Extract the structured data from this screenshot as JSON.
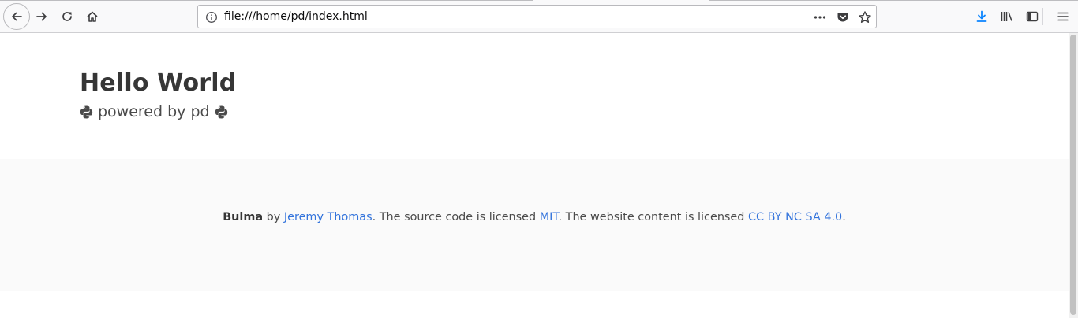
{
  "browser": {
    "url": "file:///home/pd/index.html",
    "icons": {
      "back": "arrow-left-icon",
      "forward": "arrow-right-icon",
      "reload": "reload-icon",
      "home": "home-icon",
      "info": "info-icon",
      "more": "more-dots-icon",
      "pocket": "pocket-icon",
      "bookmark": "star-icon",
      "downloads": "download-icon",
      "library": "library-icon",
      "sidebar": "sidebar-icon",
      "menu": "hamburger-menu-icon"
    },
    "colors": {
      "download_accent": "#0a84ff"
    }
  },
  "hero": {
    "title": "Hello World",
    "subtitle": "powered by pd",
    "subtitle_icon": "python-icon"
  },
  "footer": {
    "brand": "Bulma",
    "by": " by ",
    "author": "Jeremy Thomas",
    "source_text": ". The source code is licensed ",
    "source_license": "MIT",
    "content_text": ". The website content is licensed ",
    "content_license": "CC BY NC SA 4.0",
    "end": "."
  },
  "colors": {
    "link": "#3273dc",
    "title": "#363636",
    "text": "#4a4a4a",
    "footer_bg": "#fafafa"
  }
}
